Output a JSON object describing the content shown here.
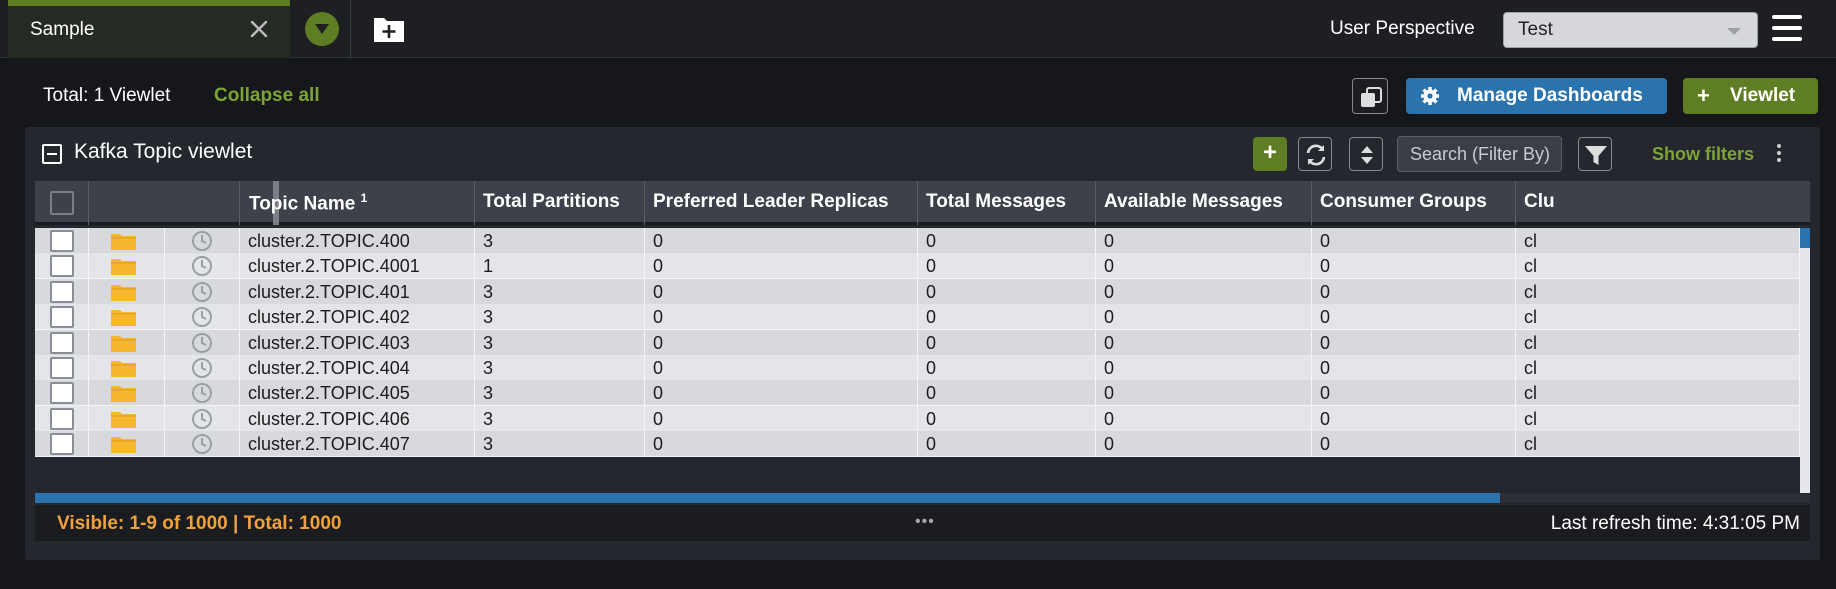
{
  "tabs": [
    {
      "label": "Sample"
    }
  ],
  "header": {
    "perspective_label": "User Perspective",
    "perspective_value": "Test"
  },
  "dashboard": {
    "total_label": "Total: 1 Viewlet",
    "collapse_all": "Collapse all",
    "manage_label": "Manage Dashboards",
    "viewlet_label": "Viewlet"
  },
  "viewlet": {
    "title": "Kafka Topic viewlet",
    "search_placeholder": "Search (Filter By)",
    "show_filters": "Show filters",
    "columns": [
      {
        "label": "Topic Name",
        "sort_index": "1"
      },
      {
        "label": "Total Partitions"
      },
      {
        "label": "Preferred Leader Replicas"
      },
      {
        "label": "Total Messages"
      },
      {
        "label": "Available Messages"
      },
      {
        "label": "Consumer Groups"
      },
      {
        "label": "Clu"
      }
    ],
    "rows": [
      [
        "cluster.2.TOPIC.400",
        "3",
        "0",
        "0",
        "0",
        "0",
        "cl"
      ],
      [
        "cluster.2.TOPIC.4001",
        "1",
        "0",
        "0",
        "0",
        "0",
        "cl"
      ],
      [
        "cluster.2.TOPIC.401",
        "3",
        "0",
        "0",
        "0",
        "0",
        "cl"
      ],
      [
        "cluster.2.TOPIC.402",
        "3",
        "0",
        "0",
        "0",
        "0",
        "cl"
      ],
      [
        "cluster.2.TOPIC.403",
        "3",
        "0",
        "0",
        "0",
        "0",
        "cl"
      ],
      [
        "cluster.2.TOPIC.404",
        "3",
        "0",
        "0",
        "0",
        "0",
        "cl"
      ],
      [
        "cluster.2.TOPIC.405",
        "3",
        "0",
        "0",
        "0",
        "0",
        "cl"
      ],
      [
        "cluster.2.TOPIC.406",
        "3",
        "0",
        "0",
        "0",
        "0",
        "cl"
      ],
      [
        "cluster.2.TOPIC.407",
        "3",
        "0",
        "0",
        "0",
        "0",
        "cl"
      ]
    ],
    "footer_visible": "Visible: 1-9 of 1000 | Total: 1000",
    "footer_dots": "•••",
    "footer_refresh": "Last refresh time: 4:31:05 PM"
  },
  "colors": {
    "accent_green": "#5f7d23",
    "accent_blue": "#2b73ad",
    "visible_orange": "#f0a23a",
    "folder_yellow": "#f5b630"
  },
  "icons": [
    "close-icon",
    "chevron-down-icon",
    "new-folder-icon",
    "hamburger-icon",
    "clone-icon",
    "gear-icon",
    "plus-icon",
    "refresh-icon",
    "sort-icon",
    "filter-icon",
    "kebab-icon",
    "folder-icon",
    "clock-icon"
  ]
}
